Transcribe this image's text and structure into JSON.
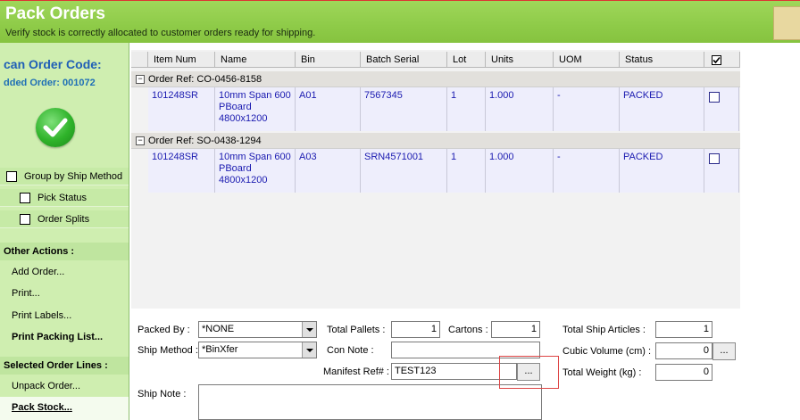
{
  "header": {
    "title": "Pack Orders",
    "subtitle": "Verify stock is correctly allocated to customer orders ready for shipping."
  },
  "sidebar": {
    "scan_title": "can Order Code:",
    "scan_status": "dded Order: 001072",
    "options": {
      "group_by_ship": "Group by Ship Method",
      "pick_status": "Pick Status",
      "order_splits": "Order Splits"
    },
    "other_actions_title": "Other Actions :",
    "other_actions": [
      "Add Order...",
      "Print...",
      "Print Labels...",
      "Print Packing List..."
    ],
    "selected_lines_title": "Selected Order Lines :",
    "selected_lines": [
      "Unpack Order...",
      "Pack Stock..."
    ]
  },
  "grid": {
    "columns": [
      "Item Num",
      "Name",
      "Bin",
      "Batch Serial",
      "Lot",
      "Units",
      "UOM",
      "Status"
    ],
    "groups": [
      {
        "label": "Order Ref: CO-0456-8158",
        "row": {
          "item_num": "101248SR",
          "name": [
            "10mm Span 600",
            "PBoard",
            "4800x1200"
          ],
          "bin": "A01",
          "batch_serial": "7567345",
          "lot": "1",
          "units": "1.000",
          "uom": "-",
          "status": "PACKED"
        }
      },
      {
        "label": "Order Ref: SO-0438-1294",
        "row": {
          "item_num": "101248SR",
          "name": [
            "10mm Span 600",
            "PBoard",
            "4800x1200"
          ],
          "bin": "A03",
          "batch_serial": "SRN4571001",
          "lot": "1",
          "units": "1.000",
          "uom": "-",
          "status": "PACKED"
        }
      }
    ]
  },
  "form": {
    "packed_by_label": "Packed By :",
    "packed_by_value": "*NONE",
    "ship_method_label": "Ship Method :",
    "ship_method_value": "*BinXfer",
    "ship_note_label": "Ship Note :",
    "total_pallets_label": "Total Pallets :",
    "total_pallets_value": "1",
    "cartons_label": "Cartons :",
    "cartons_value": "1",
    "con_note_label": "Con Note :",
    "con_note_value": "",
    "manifest_label": "Manifest Ref# :",
    "manifest_value": "TEST123",
    "browse_label": "...",
    "total_ship_articles_label": "Total Ship Articles :",
    "total_ship_articles_value": "1",
    "cubic_volume_label": "Cubic Volume (cm) :",
    "cubic_volume_value": "0",
    "total_weight_label": "Total Weight (kg) :",
    "total_weight_value": "0"
  },
  "colors": {
    "header_green": "#8ecb48",
    "sidebar_green": "#cfeeb0",
    "link_blue": "#1f5fb6",
    "row_text_blue": "#1a1ab0"
  }
}
